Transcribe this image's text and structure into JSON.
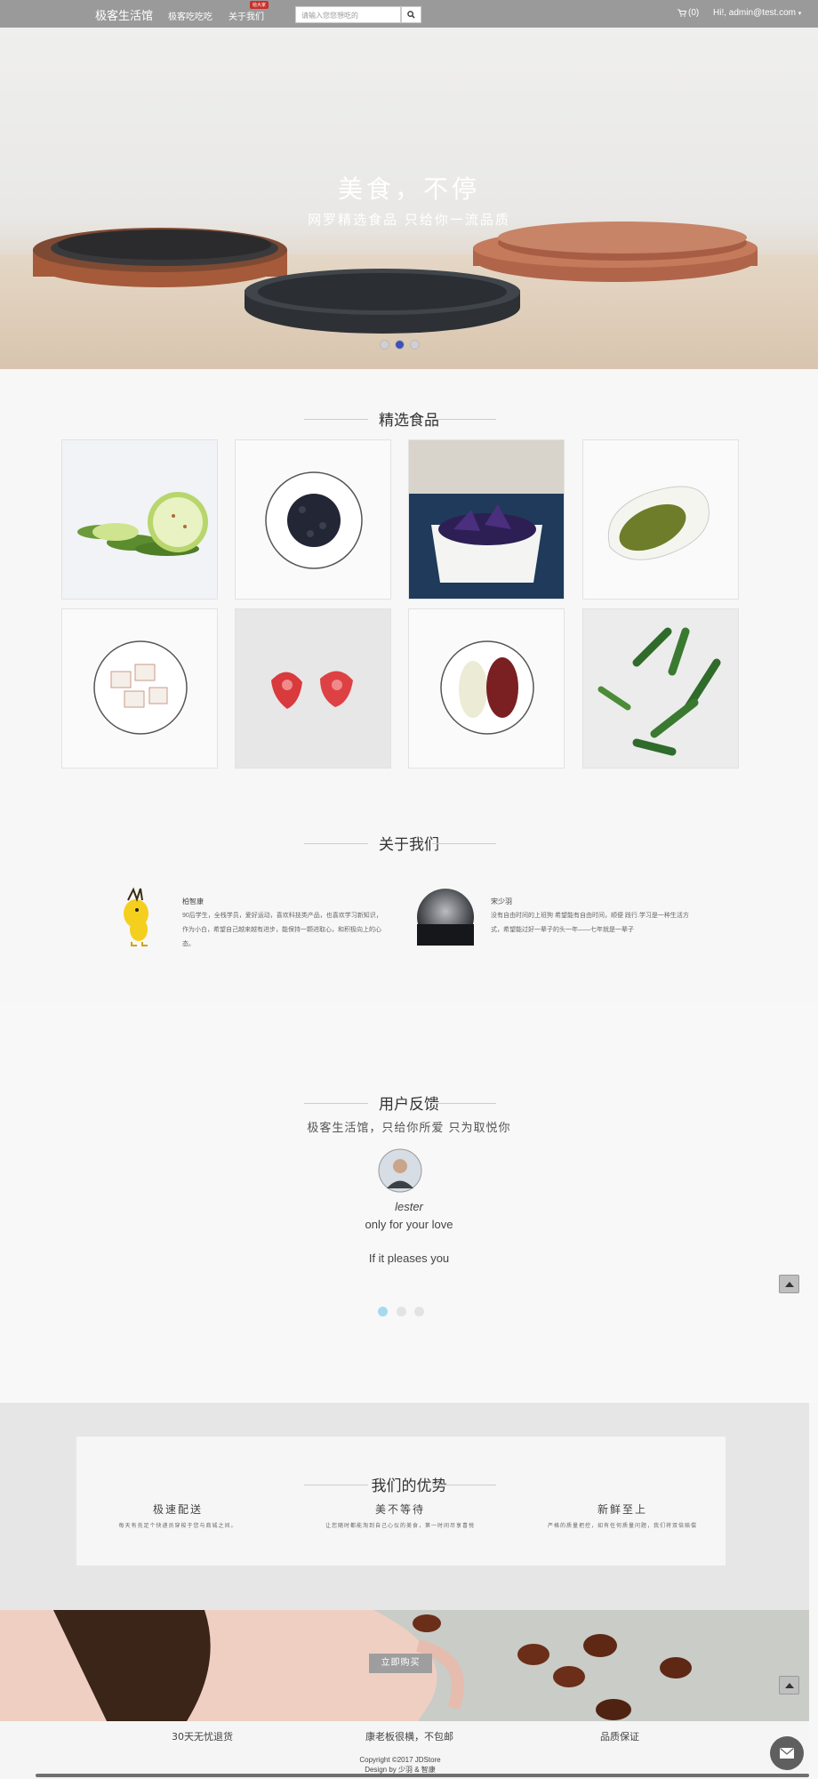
{
  "navbar": {
    "brand": "极客生活馆",
    "links": [
      "极客吃吃吃",
      "关于我们"
    ],
    "badge": "给大家",
    "search_placeholder": "请输入您您想吃的",
    "cart": "(0)",
    "user": "Hi!, admin@test.com"
  },
  "hero": {
    "title": "美食，不停",
    "subtitle": "网罗精选食品 只给你一流品质",
    "active_slide": 2,
    "slide_count": 3
  },
  "products": {
    "title": "精选食品"
  },
  "about": {
    "title": "关于我们",
    "members": [
      {
        "name": "柏智康",
        "desc": "90后学生，全栈学员，爱好运动，喜欢科技类产品，也喜欢学习新知识，作为小白，希望自己越来越有进步，能保持一颗进取心，和积极向上的心态。"
      },
      {
        "name": "宋少羽",
        "desc": "没有自由时间的上班狗 希望能有自由时间，顺便 践行.学习是一种生活方式，希望能过好一辈子的头一年——七年就是一辈子"
      }
    ]
  },
  "feedback": {
    "title": "用户反馈",
    "subtitle": "极客生活馆，只给你所爱 只为取悦你",
    "name": "lester",
    "line1": "only for your love",
    "line2": "If it pleases you",
    "active_dot": 1,
    "dot_count": 3
  },
  "advantages": {
    "title": "我们的优势",
    "items": [
      {
        "title": "极速配送",
        "desc": "每天有充足个快递员穿梭于您与商城之间。"
      },
      {
        "title": "美不等待",
        "desc": "让您随时都能淘到自己心仪的美食，第一时间尽享喜悦"
      },
      {
        "title": "新鲜至上",
        "desc": "严格的质量把控，如有任何质量问题，我们将双倍赔偿"
      }
    ]
  },
  "banner": {
    "button": "立即购买"
  },
  "footer": {
    "items": [
      "30天无忧退货",
      "康老板很横，不包邮",
      "品质保证"
    ],
    "copyright": "Copyright ©2017 JDStore",
    "design": "Design by 少羽 & 智康"
  }
}
